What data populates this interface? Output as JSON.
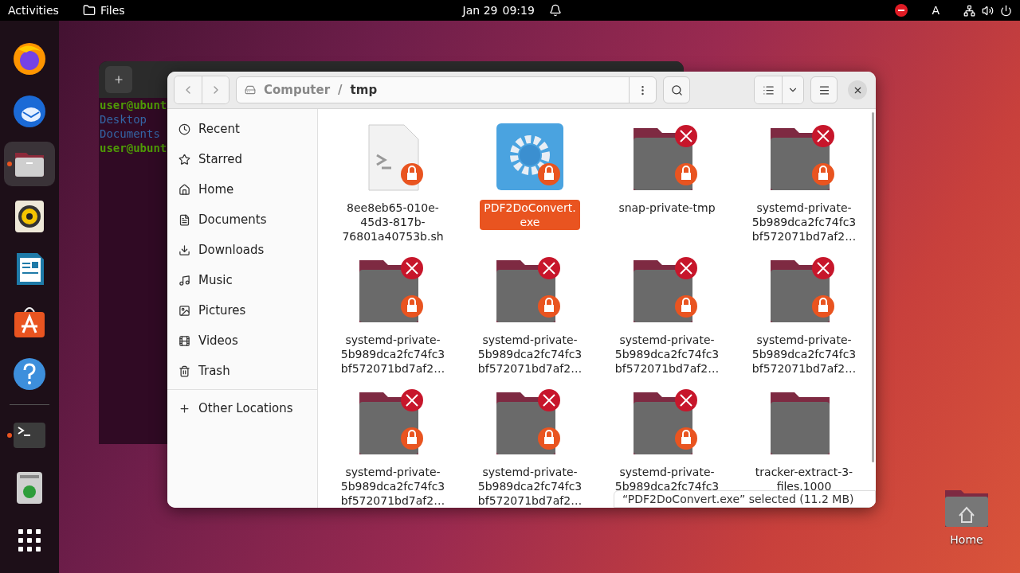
{
  "top_bar": {
    "activities": "Activities",
    "app": "Files",
    "date": "Jan 29",
    "time": "09:19"
  },
  "top_bar_indicators": {
    "keyboard_layout": "A"
  },
  "dock": [
    {
      "kind": "firefox",
      "running": false,
      "selected": false
    },
    {
      "kind": "thunderbird",
      "running": false,
      "selected": false
    },
    {
      "kind": "files",
      "running": true,
      "selected": true
    },
    {
      "kind": "rhythmbox",
      "running": false,
      "selected": false
    },
    {
      "kind": "writer",
      "running": false,
      "selected": false
    },
    {
      "kind": "software",
      "running": false,
      "selected": false
    },
    {
      "kind": "help",
      "running": false,
      "selected": false
    },
    {
      "kind": "terminal",
      "running": true,
      "selected": false
    },
    {
      "kind": "trash",
      "running": false,
      "selected": false
    },
    {
      "kind": "apps",
      "running": false,
      "selected": false
    }
  ],
  "terminal": {
    "lines": [
      {
        "text": "user@ubunt",
        "kind": "prompt"
      },
      {
        "text": "Desktop",
        "kind": "dir"
      },
      {
        "text": "Documents",
        "kind": "dir"
      },
      {
        "text": "user@ubunt",
        "kind": "prompt"
      }
    ]
  },
  "files": {
    "path_separator": "/",
    "path": [
      {
        "label": "Computer",
        "current": false
      },
      {
        "label": "tmp",
        "current": true
      }
    ],
    "sidebar": [
      {
        "label": "Recent",
        "selected": false
      },
      {
        "label": "Starred",
        "selected": false
      },
      {
        "label": "Home",
        "selected": false
      },
      {
        "label": "Documents",
        "selected": false
      },
      {
        "label": "Downloads",
        "selected": false
      },
      {
        "label": "Music",
        "selected": false
      },
      {
        "label": "Pictures",
        "selected": false
      },
      {
        "label": "Videos",
        "selected": false
      },
      {
        "label": "Trash",
        "selected": false
      }
    ],
    "other_locations": "Other Locations",
    "items": [
      {
        "kind": "script",
        "locked": true,
        "unreadable": false,
        "selected": false,
        "lines": [
          "8ee8eb65-010e-",
          "45d3-817b-",
          "76801a40753b.sh"
        ]
      },
      {
        "kind": "exe",
        "locked": true,
        "unreadable": false,
        "selected": true,
        "lines": [
          "PDF2DoConvert.",
          "exe"
        ]
      },
      {
        "kind": "folder",
        "locked": true,
        "unreadable": true,
        "selected": false,
        "lines": [
          "snap-private-tmp"
        ]
      },
      {
        "kind": "folder",
        "locked": true,
        "unreadable": true,
        "selected": false,
        "lines": [
          "systemd-private-",
          "5b989dca2fc74fc3",
          "bf572071bd7af2…"
        ]
      },
      {
        "kind": "folder",
        "locked": true,
        "unreadable": true,
        "selected": false,
        "lines": [
          "systemd-private-",
          "5b989dca2fc74fc3",
          "bf572071bd7af2…"
        ]
      },
      {
        "kind": "folder",
        "locked": true,
        "unreadable": true,
        "selected": false,
        "lines": [
          "systemd-private-",
          "5b989dca2fc74fc3",
          "bf572071bd7af2…"
        ]
      },
      {
        "kind": "folder",
        "locked": true,
        "unreadable": true,
        "selected": false,
        "lines": [
          "systemd-private-",
          "5b989dca2fc74fc3",
          "bf572071bd7af2…"
        ]
      },
      {
        "kind": "folder",
        "locked": true,
        "unreadable": true,
        "selected": false,
        "lines": [
          "systemd-private-",
          "5b989dca2fc74fc3",
          "bf572071bd7af2…"
        ]
      },
      {
        "kind": "folder",
        "locked": true,
        "unreadable": true,
        "selected": false,
        "lines": [
          "systemd-private-",
          "5b989dca2fc74fc3",
          "bf572071bd7af2…"
        ]
      },
      {
        "kind": "folder",
        "locked": true,
        "unreadable": true,
        "selected": false,
        "lines": [
          "systemd-private-",
          "5b989dca2fc74fc3",
          "bf572071bd7af2…"
        ]
      },
      {
        "kind": "folder",
        "locked": true,
        "unreadable": true,
        "selected": false,
        "lines": [
          "systemd-private-",
          "5b989dca2fc74fc3"
        ]
      },
      {
        "kind": "folder",
        "locked": false,
        "unreadable": false,
        "selected": false,
        "lines": [
          "tracker-extract-3-",
          "files.1000"
        ]
      }
    ],
    "status": "“PDF2DoConvert.exe” selected (11.2 MB)"
  },
  "desktop_icons": [
    {
      "label": "Home"
    }
  ]
}
